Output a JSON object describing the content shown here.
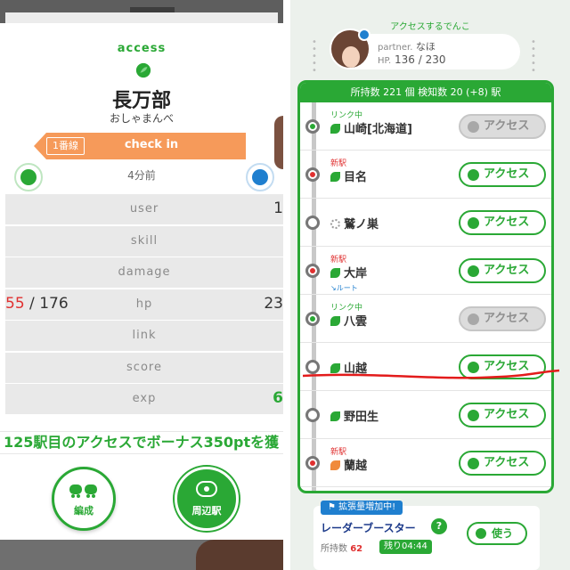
{
  "left": {
    "access_label": "access",
    "station_name": "長万部",
    "station_sub": "おしゃまんべ",
    "line_badge": "1番線",
    "checkin_label": "check in",
    "time_ago": "4分前",
    "stats": {
      "user": "user",
      "skill": "skill",
      "damage": "damage",
      "hp": "hp",
      "link": "link",
      "score": "score",
      "exp": "exp"
    },
    "hp_left_current": "55",
    "hp_left_sep": " / ",
    "hp_left_max": "176",
    "hp_right_partial": "23",
    "user_right_partial": "1",
    "exp_right_partial": "6",
    "bonus_text": "125駅目のアクセスでボーナス350ptを獲",
    "buttons": {
      "hensei": "編成",
      "shuhen": "周辺駅"
    }
  },
  "right": {
    "title": "アクセスするでんこ",
    "partner": {
      "name_key": "partner.",
      "name": "なほ",
      "hp_key": "HP.",
      "hp_value": "136 / 230"
    },
    "header": "所持数 221 個 検知数 20 (+8) 駅",
    "stations": [
      {
        "tag": "リンク中",
        "tag_type": "link",
        "name": "山崎[北海道]",
        "icon": "green",
        "node": "link",
        "button": "アクセス",
        "enabled": false
      },
      {
        "tag": "新駅",
        "tag_type": "new",
        "name": "目名",
        "icon": "green",
        "node": "new",
        "button": "アクセス",
        "enabled": true
      },
      {
        "tag": "",
        "tag_type": "",
        "name": "鷲ノ巣",
        "icon": "dotted",
        "node": "plain",
        "button": "アクセス",
        "enabled": true
      },
      {
        "tag": "新駅",
        "tag_type": "new",
        "name": "大岸",
        "icon": "green",
        "node": "new",
        "button": "アクセス",
        "enabled": true,
        "route": "ルート"
      },
      {
        "tag": "リンク中",
        "tag_type": "link",
        "name": "八雲",
        "icon": "green",
        "node": "link",
        "button": "アクセス",
        "enabled": false
      },
      {
        "tag": "",
        "tag_type": "",
        "name": "山越",
        "icon": "green",
        "node": "plain",
        "button": "アクセス",
        "enabled": true
      },
      {
        "tag": "",
        "tag_type": "",
        "name": "野田生",
        "icon": "green",
        "node": "plain",
        "button": "アクセス",
        "enabled": true
      },
      {
        "tag": "新駅",
        "tag_type": "new",
        "name": "蘭越",
        "icon": "orange",
        "node": "new",
        "button": "アクセス",
        "enabled": true
      }
    ],
    "radar": {
      "flag": "拡張量増加中!",
      "name": "レーダーブースター",
      "help": "?",
      "count_label": "所持数",
      "count_value": "62",
      "remain": "残り04:44",
      "use_label": "使う"
    }
  },
  "colors": {
    "green": "#2aa835",
    "orange": "#f69a5a",
    "red": "#e03030",
    "blue": "#1f7fcf",
    "annotation_red": "#e31b1b"
  }
}
